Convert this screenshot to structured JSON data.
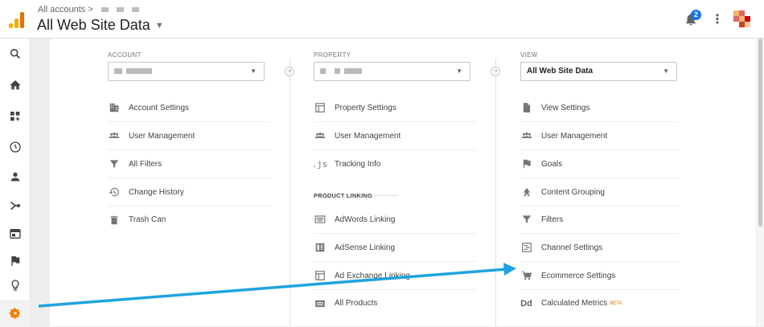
{
  "header": {
    "breadcrumb": "All accounts >",
    "title": "All Web Site Data",
    "notification_count": "2"
  },
  "account": {
    "label": "ACCOUNT",
    "items": [
      {
        "label": "Account Settings",
        "icon": "building-icon"
      },
      {
        "label": "User Management",
        "icon": "users-icon"
      },
      {
        "label": "All Filters",
        "icon": "filter-icon"
      },
      {
        "label": "Change History",
        "icon": "history-icon"
      },
      {
        "label": "Trash Can",
        "icon": "trash-icon"
      }
    ]
  },
  "property": {
    "label": "PROPERTY",
    "items": [
      {
        "label": "Property Settings",
        "icon": "window-icon"
      },
      {
        "label": "User Management",
        "icon": "users-icon"
      },
      {
        "label": "Tracking Info",
        "icon": "js-icon"
      }
    ],
    "section": "PRODUCT LINKING",
    "linking": [
      {
        "label": "AdWords Linking",
        "icon": "keyboard-icon"
      },
      {
        "label": "AdSense Linking",
        "icon": "adsense-icon"
      },
      {
        "label": "Ad Exchange Linking",
        "icon": "window-icon"
      },
      {
        "label": "All Products",
        "icon": "link-icon"
      }
    ]
  },
  "view": {
    "label": "VIEW",
    "selected": "All Web Site Data",
    "items": [
      {
        "label": "View Settings",
        "icon": "document-icon"
      },
      {
        "label": "User Management",
        "icon": "users-icon"
      },
      {
        "label": "Goals",
        "icon": "flag-icon"
      },
      {
        "label": "Content Grouping",
        "icon": "walk-icon"
      },
      {
        "label": "Filters",
        "icon": "filter-icon"
      },
      {
        "label": "Channel Settings",
        "icon": "channel-icon"
      },
      {
        "label": "Ecommerce Settings",
        "icon": "cart-icon"
      },
      {
        "label": "Calculated Metrics",
        "icon": "dd-icon",
        "badge": "BETA"
      }
    ]
  },
  "colors": {
    "accent_orange": "#f57c00",
    "annotation_arrow": "#1fa3e0",
    "badge_blue": "#1a73e8"
  }
}
